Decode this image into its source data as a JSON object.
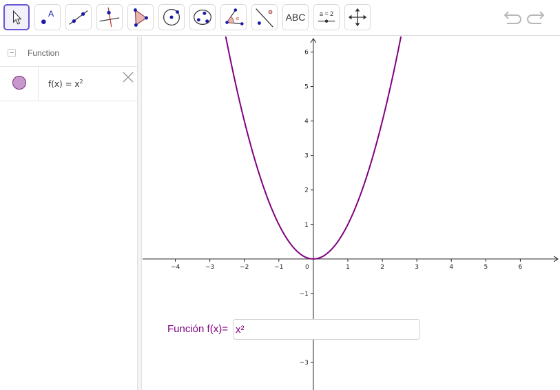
{
  "toolbar": {
    "tools": [
      {
        "icon": "move-pointer-icon",
        "selected": true
      },
      {
        "icon": "point-icon"
      },
      {
        "icon": "line-icon"
      },
      {
        "icon": "perpendicular-line-icon"
      },
      {
        "icon": "polygon-icon"
      },
      {
        "icon": "circle-center-point-icon"
      },
      {
        "icon": "conic-through-points-icon"
      },
      {
        "icon": "angle-icon"
      },
      {
        "icon": "reflect-about-line-icon"
      },
      {
        "icon": "text-tool-icon",
        "label": "ABC"
      },
      {
        "icon": "slider-icon",
        "label": "a = 2"
      },
      {
        "icon": "move-graphics-view-icon"
      }
    ],
    "undo_icon": "undo-icon",
    "redo_icon": "redo-icon"
  },
  "algebra": {
    "group_label": "Function",
    "items": [
      {
        "name": "f",
        "expr": "f(x)  =  x",
        "exponent": "2",
        "color": "#800080"
      }
    ]
  },
  "graph": {
    "x_range": [
      -4.95,
      7.15
    ],
    "y_range": [
      -3.8,
      6.45
    ],
    "x_ticks": [
      "−4",
      "−3",
      "−2",
      "−1",
      "0",
      "1",
      "2",
      "3",
      "4",
      "5",
      "6"
    ],
    "y_ticks": [
      "6",
      "5",
      "4",
      "3",
      "2",
      "1",
      "−1",
      "−3"
    ],
    "curve_color": "#800080",
    "function": "x^2"
  },
  "input_box": {
    "caption": "Función f(x)=",
    "value": "x²"
  }
}
